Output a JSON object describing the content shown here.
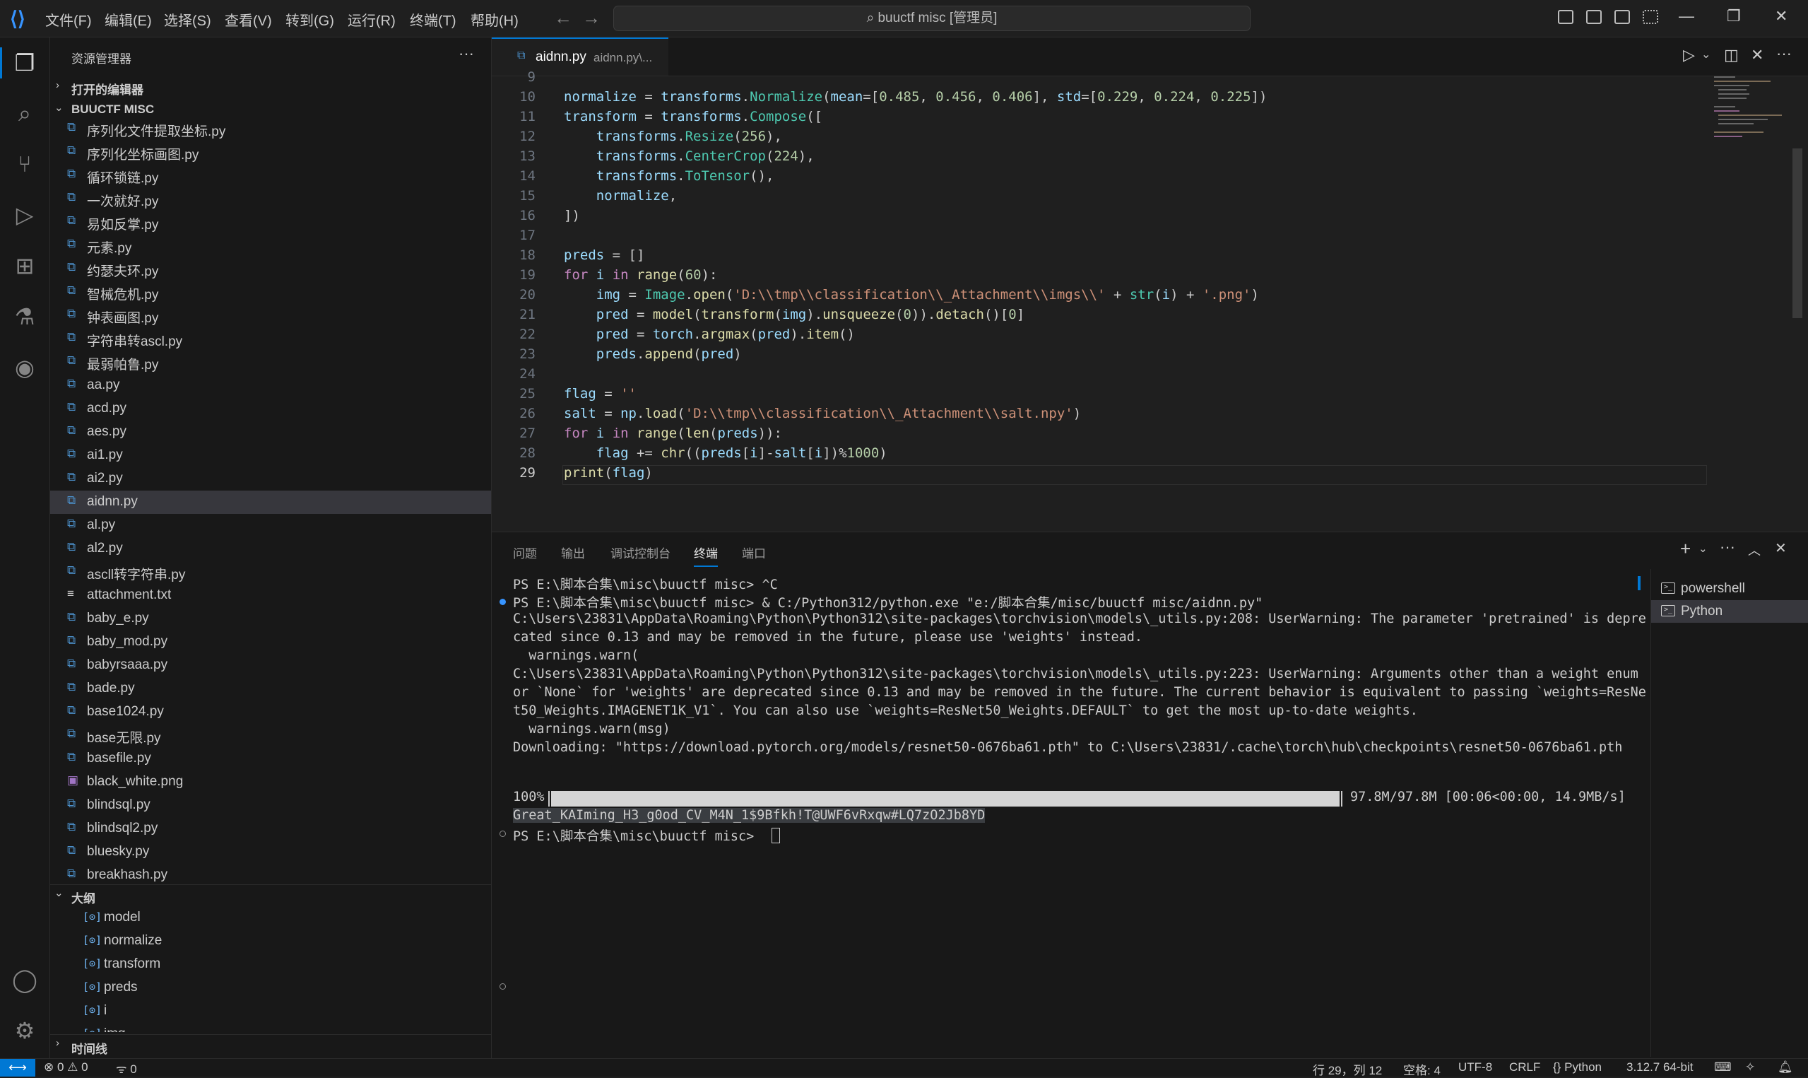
{
  "menu": [
    "文件(F)",
    "编辑(E)",
    "选择(S)",
    "查看(V)",
    "转到(G)",
    "运行(R)",
    "终端(T)",
    "帮助(H)"
  ],
  "command_center": "buuctf misc [管理员]",
  "sidebar": {
    "title": "资源管理器",
    "open_editors": "打开的编辑器",
    "folder": "BUUCTF MISC",
    "files": [
      "序列化文件提取坐标.py",
      "序列化坐标画图.py",
      "循环锁链.py",
      "一次就好.py",
      "易如反掌.py",
      "元素.py",
      "约瑟夫环.py",
      "智械危机.py",
      "钟表画图.py",
      "字符串转ascl.py",
      "最弱帕鲁.py",
      "aa.py",
      "acd.py",
      "aes.py",
      "ai1.py",
      "ai2.py",
      "aidnn.py",
      "al.py",
      "al2.py",
      "ascll转字符串.py",
      "attachment.txt",
      "baby_e.py",
      "baby_mod.py",
      "babyrsaaa.py",
      "bade.py",
      "base1024.py",
      "base无限.py",
      "basefile.py",
      "black_white.png",
      "blindsql.py",
      "blindsql2.py",
      "bluesky.py",
      "breakhash.py"
    ],
    "active_file": "aidnn.py",
    "outline_title": "大纲",
    "outline": [
      "model",
      "normalize",
      "transform",
      "preds",
      "i",
      "img"
    ],
    "timeline": "时间线"
  },
  "tab": {
    "name": "aidnn.py",
    "desc": "aidnn.py\\..."
  },
  "editor": {
    "first_line_number": "9",
    "current_line": "29"
  },
  "panel": {
    "tabs": [
      "问题",
      "输出",
      "调试控制台",
      "终端",
      "端口"
    ],
    "active_tab": "终端",
    "terminal_lines": [
      "PS E:\\脚本合集\\misc\\buuctf misc> ^C",
      "PS E:\\脚本合集\\misc\\buuctf misc> & C:/Python312/python.exe \"e:/脚本合集/misc/buuctf misc/aidnn.py\"",
      "C:\\Users\\23831\\AppData\\Roaming\\Python\\Python312\\site-packages\\torchvision\\models\\_utils.py:208: UserWarning: The parameter 'pretrained' is depre",
      "cated since 0.13 and may be removed in the future, please use 'weights' instead.",
      "  warnings.warn(",
      "C:\\Users\\23831\\AppData\\Roaming\\Python\\Python312\\site-packages\\torchvision\\models\\_utils.py:223: UserWarning: Arguments other than a weight enum",
      "or `None` for 'weights' are deprecated since 0.13 and may be removed in the future. The current behavior is equivalent to passing `weights=ResNe",
      "t50_Weights.IMAGENET1K_V1`. You can also use `weights=ResNet50_Weights.DEFAULT` to get the most up-to-date weights.",
      "  warnings.warn(msg)",
      "Downloading: \"https://download.pytorch.org/models/resnet50-0676ba61.pth\" to C:\\Users\\23831/.cache\\torch\\hub\\checkpoints\\resnet50-0676ba61.pth"
    ],
    "progress_prefix": "100%",
    "progress_value": 1.0,
    "progress_suffix": "97.8M/97.8M [00:06<00:00, 14.9MB/s]",
    "flag_line": "Great_KAIming_H3_g0od_CV_M4N_1$9Bfkh!T@UWF6vRxqw#LQ7zO2Jb8YD",
    "prompt": "PS E:\\脚本合集\\misc\\buuctf misc> ",
    "terminals": [
      "powershell",
      "Python"
    ],
    "active_terminal": "Python"
  },
  "statusbar": {
    "errors": "0",
    "warnings": "0",
    "ports": "0",
    "position": "行 29，列 12",
    "spaces": "空格: 4",
    "encoding": "UTF-8",
    "eol": "CRLF",
    "language": "{} Python",
    "interpreter": "3.12.7 64-bit"
  },
  "colors": {
    "accent": "#0078d4",
    "keyword": "#c586c0",
    "function": "#dcdcaa",
    "class": "#4ec9b0",
    "string": "#ce9178",
    "number": "#b5cea8",
    "variable": "#9cdcfe"
  }
}
